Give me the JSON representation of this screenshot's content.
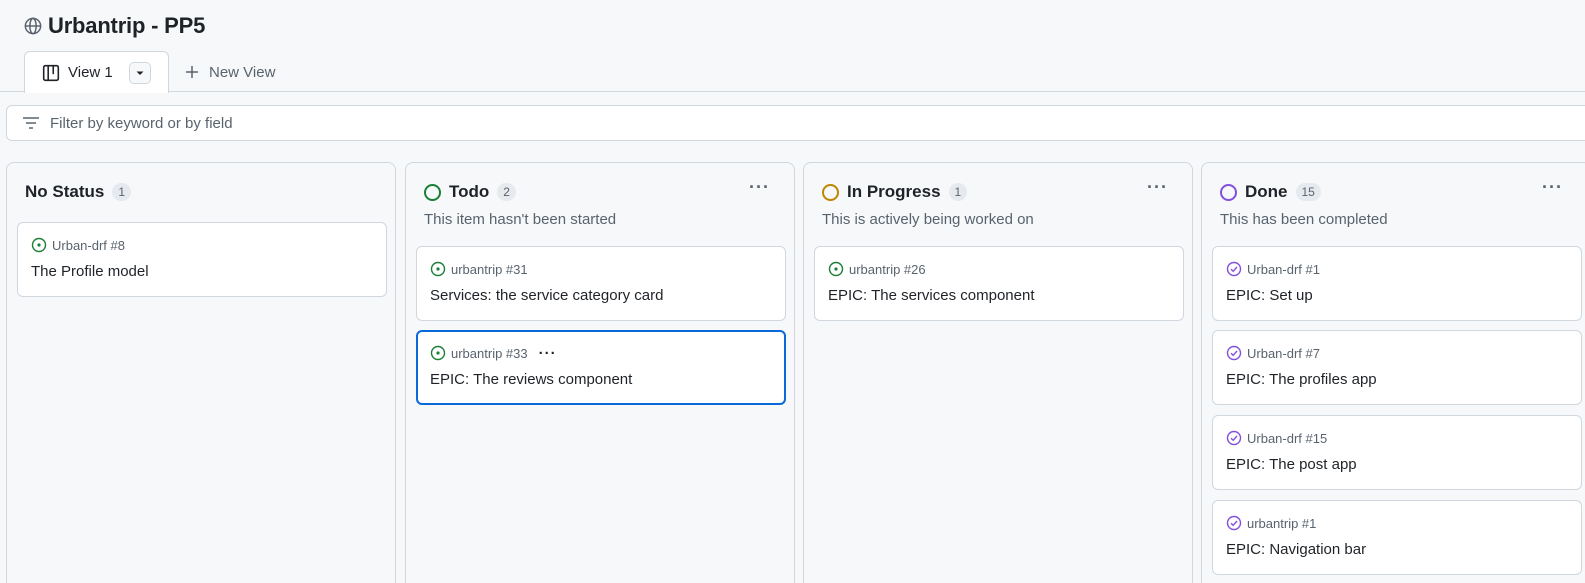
{
  "project": {
    "title": "Urbantrip - PP5",
    "icon": "globe-icon"
  },
  "views": {
    "active_tab": {
      "label": "View 1",
      "icon": "board-icon",
      "dropdown_icon": "caret-down-icon"
    },
    "new_view": {
      "label": "New View",
      "icon": "plus-icon"
    }
  },
  "filter": {
    "placeholder": "Filter by keyword or by field",
    "value": "",
    "icon": "filter-icon"
  },
  "colors": {
    "todo": "#1a7f37",
    "in_progress": "#bf8700",
    "done": "#8250df",
    "selected_border": "#0969da"
  },
  "columns": [
    {
      "name": "No Status",
      "count": "1",
      "description": "",
      "cards": [
        {
          "repo": "Urban-drf #8",
          "title": "The Profile model",
          "state": "open"
        }
      ]
    },
    {
      "name": "Todo",
      "count": "2",
      "description": "This item hasn't been started",
      "cards": [
        {
          "repo": "urbantrip #31",
          "title": "Services: the service category card",
          "state": "open"
        },
        {
          "repo": "urbantrip #33",
          "title": "EPIC: The reviews component",
          "state": "open",
          "selected": true
        }
      ]
    },
    {
      "name": "In Progress",
      "count": "1",
      "description": "This is actively being worked on",
      "cards": [
        {
          "repo": "urbantrip #26",
          "title": "EPIC: The services component",
          "state": "open"
        }
      ]
    },
    {
      "name": "Done",
      "count": "15",
      "description": "This has been completed",
      "cards": [
        {
          "repo": "Urban-drf #1",
          "title": "EPIC: Set up",
          "state": "closed"
        },
        {
          "repo": "Urban-drf #7",
          "title": "EPIC: The profiles app",
          "state": "closed"
        },
        {
          "repo": "Urban-drf #15",
          "title": "EPIC: The post app",
          "state": "closed"
        },
        {
          "repo": "urbantrip #1",
          "title": "EPIC: Navigation bar",
          "state": "closed"
        }
      ]
    }
  ]
}
